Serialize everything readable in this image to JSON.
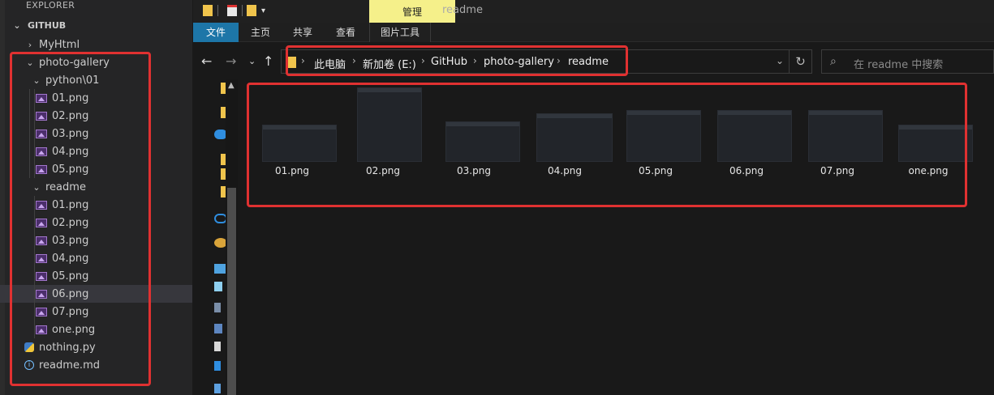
{
  "vscode": {
    "explorer_title": "EXPLORER",
    "workspace": "GITHUB",
    "tree": [
      {
        "label": "MyHtml",
        "kind": "folder-collapsed"
      },
      {
        "label": "photo-gallery",
        "kind": "folder-open"
      },
      {
        "label": "python\\01",
        "kind": "folder-open"
      },
      {
        "label": "01.png",
        "kind": "image"
      },
      {
        "label": "02.png",
        "kind": "image"
      },
      {
        "label": "03.png",
        "kind": "image"
      },
      {
        "label": "04.png",
        "kind": "image"
      },
      {
        "label": "05.png",
        "kind": "image"
      },
      {
        "label": "readme",
        "kind": "folder-open"
      },
      {
        "label": "01.png",
        "kind": "image"
      },
      {
        "label": "02.png",
        "kind": "image"
      },
      {
        "label": "03.png",
        "kind": "image"
      },
      {
        "label": "04.png",
        "kind": "image"
      },
      {
        "label": "05.png",
        "kind": "image"
      },
      {
        "label": "06.png",
        "kind": "image",
        "selected": true
      },
      {
        "label": "07.png",
        "kind": "image"
      },
      {
        "label": "one.png",
        "kind": "image"
      },
      {
        "label": "nothing.py",
        "kind": "python"
      },
      {
        "label": "readme.md",
        "kind": "info"
      }
    ]
  },
  "explorer": {
    "window_title": "readme",
    "context_tab": "管理",
    "ribbon_tabs": [
      "文件",
      "主页",
      "共享",
      "查看",
      "图片工具"
    ],
    "breadcrumb": [
      "此电脑",
      "新加卷 (E:)",
      "GitHub",
      "photo-gallery",
      "readme"
    ],
    "search_placeholder": "在 readme 中搜索",
    "files": [
      "01.png",
      "02.png",
      "03.png",
      "04.png",
      "05.png",
      "06.png",
      "07.png",
      "one.png"
    ]
  }
}
